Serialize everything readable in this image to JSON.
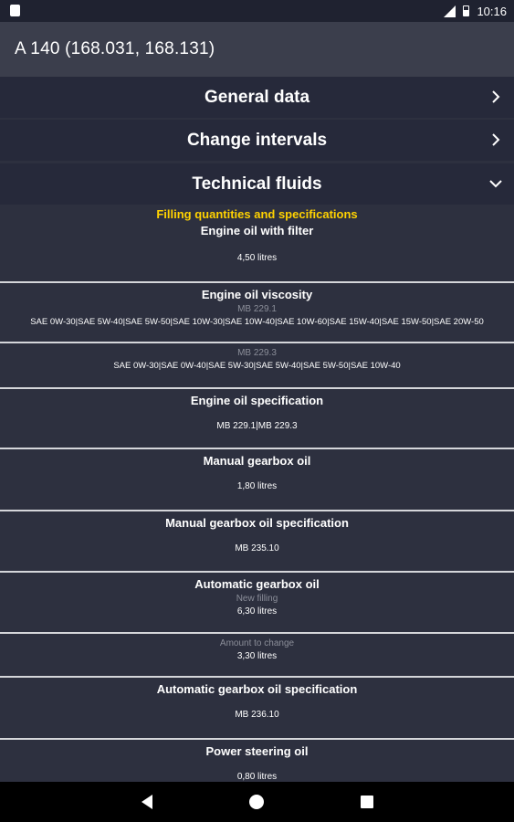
{
  "status_bar": {
    "time": "10:16"
  },
  "app_bar": {
    "title": "A 140 (168.031, 168.131)"
  },
  "sections": [
    {
      "label": "General data",
      "state": "collapsed"
    },
    {
      "label": "Change intervals",
      "state": "collapsed"
    },
    {
      "label": "Technical fluids",
      "state": "expanded"
    }
  ],
  "technical_fluids": {
    "subtitle": "Filling quantities and specifications",
    "engine_oil": {
      "title": "Engine oil with filter",
      "value": "4,50 litres"
    },
    "engine_oil_viscosity": {
      "title": "Engine oil viscosity",
      "spec1": "MB 229.1",
      "values1": "SAE 0W-30|SAE 5W-40|SAE 5W-50|SAE 10W-30|SAE 10W-40|SAE 10W-60|SAE 15W-40|SAE 15W-50|SAE 20W-50",
      "spec2": "MB 229.3",
      "values2": "SAE 0W-30|SAE 0W-40|SAE 5W-30|SAE 5W-40|SAE 5W-50|SAE 10W-40"
    },
    "engine_oil_spec": {
      "title": "Engine oil specification",
      "value": "MB 229.1|MB 229.3"
    },
    "manual_gearbox": {
      "title": "Manual gearbox oil",
      "value": "1,80 litres"
    },
    "manual_gearbox_spec": {
      "title": "Manual gearbox oil specification",
      "value": "MB 235.10"
    },
    "auto_gearbox": {
      "title": "Automatic gearbox oil",
      "label1": "New filling",
      "value1": "6,30 litres",
      "label2": "Amount to change",
      "value2": "3,30 litres"
    },
    "auto_gearbox_spec": {
      "title": "Automatic gearbox oil specification",
      "value": "MB 236.10"
    },
    "power_steering": {
      "title": "Power steering oil",
      "value": "0,80 litres"
    }
  },
  "colors": {
    "accent": "#ffd200",
    "background": "#2d303f",
    "header": "#26293a",
    "app_bar": "#3b3e4c"
  }
}
